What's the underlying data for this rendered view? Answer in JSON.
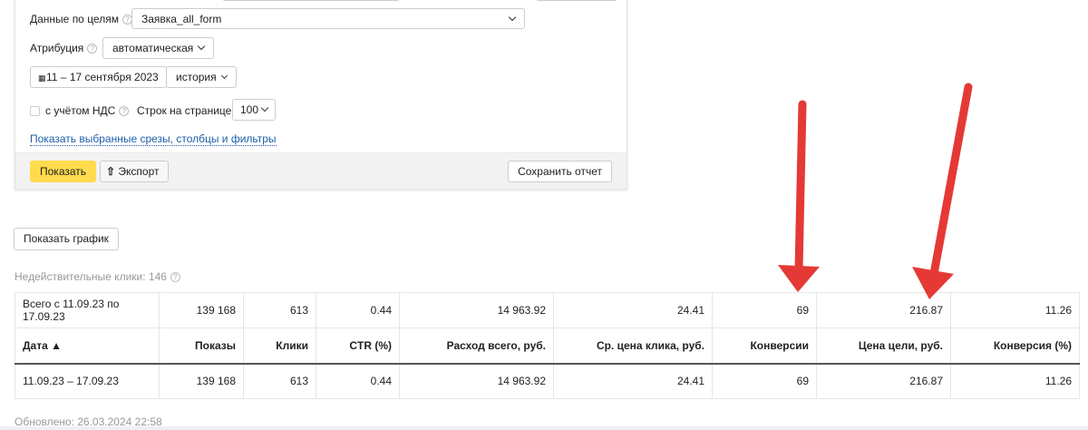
{
  "filters": {
    "goals_label": "Данные по целям",
    "goals_value": "Заявка_all_form",
    "attribution_label": "Атрибуция",
    "attribution_value": "автоматическая",
    "date_range": "11 – 17 сентября 2023",
    "history": "история",
    "vat_label": "с учётом НДС",
    "rows_label": "Строк на странице",
    "rows_value": "100",
    "show_selected_link": "Показать выбранные срезы, столбцы и фильтры"
  },
  "footer": {
    "show": "Показать",
    "export": "Экспорт",
    "save": "Сохранить отчет"
  },
  "show_chart": "Показать график",
  "invalid_clicks": "Недействительные клики: 146",
  "table": {
    "total": [
      "Всего с 11.09.23 по 17.09.23",
      "139 168",
      "613",
      "0.44",
      "14 963.92",
      "24.41",
      "69",
      "216.87",
      "11.26"
    ],
    "headers": [
      "Дата ▲",
      "Показы",
      "Клики",
      "CTR (%)",
      "Расход всего, руб.",
      "Ср. цена клика, руб.",
      "Конверсии",
      "Цена цели, руб.",
      "Конверсия (%)"
    ],
    "rows": [
      [
        "11.09.23 – 17.09.23",
        "139 168",
        "613",
        "0.44",
        "14 963.92",
        "24.41",
        "69",
        "216.87",
        "11.26"
      ]
    ]
  },
  "updated": "Обновлено: 26.03.2024 22:58",
  "colors": {
    "accent": "#ffdb4d",
    "arrow": "#e53935",
    "link": "#1a5fa8"
  }
}
